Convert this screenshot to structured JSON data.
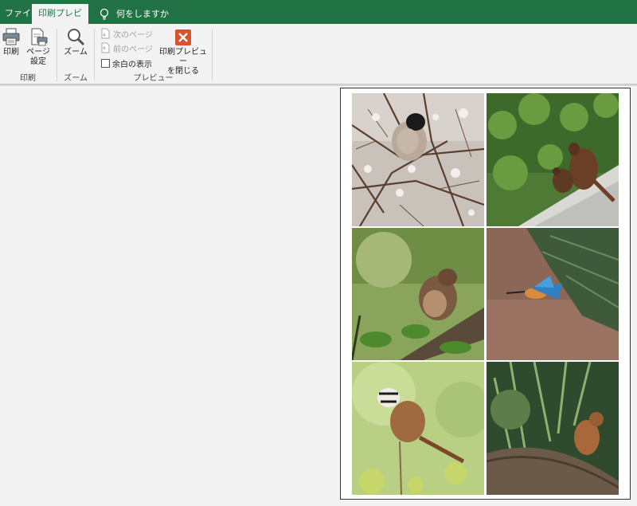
{
  "tabs": {
    "file": "ファイル",
    "print_preview": "印刷プレビュー",
    "tell_me": "何をしますか"
  },
  "ribbon": {
    "print_group": {
      "label": "印刷",
      "print_button": "印刷",
      "page_setup_line1": "ページ",
      "page_setup_line2": "設定"
    },
    "zoom_group": {
      "label": "ズーム",
      "zoom_button": "ズーム"
    },
    "preview_group": {
      "label": "プレビュー",
      "next_page": "次のページ",
      "prev_page": "前のページ",
      "show_margins": "余白の表示",
      "show_margins_checked": false,
      "close_line1": "印刷プレビュー",
      "close_line2": "を閉じる"
    }
  },
  "colors": {
    "titlebar": "#217346",
    "close_icon": "#d9532c"
  },
  "preview_photos": [
    {
      "subject": "bullfinch on blossom branch"
    },
    {
      "subject": "pheasants on path"
    },
    {
      "subject": "brown bird on branch"
    },
    {
      "subject": "kingfisher in flight"
    },
    {
      "subject": "bunting on stem"
    },
    {
      "subject": "small brown bird on log"
    }
  ]
}
